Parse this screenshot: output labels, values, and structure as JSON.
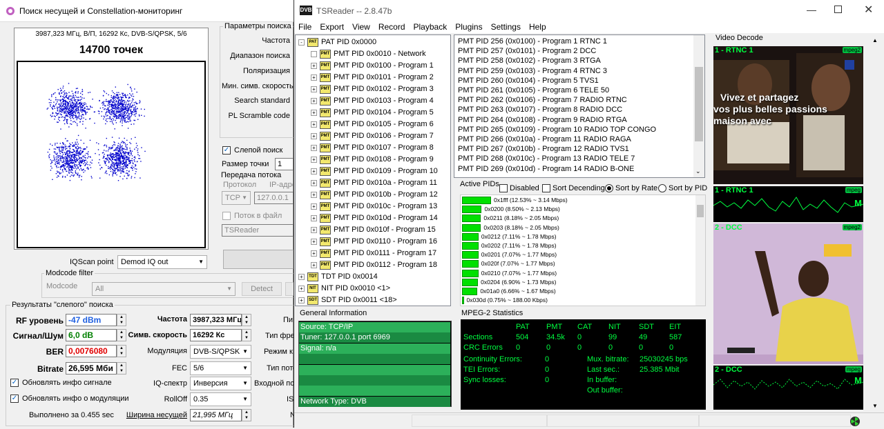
{
  "left_window": {
    "title": "Поиск несущей и Constellation-мониторинг",
    "constellation_header": "3987,323 МГц, В/П, 16292 Кс, DVB-S/QPSK, 5/6",
    "points_label": "14700 точек",
    "params_group": "Параметры поиска",
    "params_labels": [
      "Частота",
      "Диапазон поиска",
      "Поляризация",
      "Мин. симв. скорость",
      "Search standard",
      "PL Scramble code"
    ],
    "blind_search_label": "Слепой поиск",
    "point_size_label": "Размер точки",
    "point_size_value": "1",
    "stream_group": "Передача потока",
    "protocol_label": "Протокол",
    "ip_label": "IP-адре",
    "protocol_value": "TCP",
    "ip_value": "127.0.0.1",
    "stream_to_file_label": "Поток в файл",
    "tsreader_value": "TSReader",
    "iqscan_label": "IQScan point",
    "iqscan_value": "Demod IQ out",
    "modcode_group": "Modcode filter",
    "modcode_label": "Modcode",
    "modcode_value": "All",
    "detect_button": "Detect",
    "blind_results_group": "Результаты \"слепого\" поиска",
    "rf_label": "RF уровень",
    "rf_value": "-47 dBm",
    "snr_label": "Сигнал/Шум",
    "snr_value": "6,0 dB",
    "ber_label": "BER",
    "ber_value": "0,0076080",
    "bitrate_label": "Bitrate",
    "bitrate_value": "26,595 Мби",
    "freq_label": "Частота",
    "freq_value": "3987,323 МГц",
    "sr_label": "Симв. скорость",
    "sr_value": "16292 Кс",
    "mod_label": "Модуляция",
    "mod_value": "DVB-S/QPSK",
    "fec_label": "FEC",
    "fec_value": "5/6",
    "iqspec_label": "IQ-спектр",
    "iqspec_value": "Инверсия",
    "rolloff_label": "RollOff",
    "rolloff_value": "0.35",
    "width_label": "Ширина несущей",
    "width_value": "21,995 МГц",
    "update_signal_label": "Обновлять инфо сигнале",
    "update_mod_label": "Обновлять инфо о модуляции",
    "elapsed_label": "Выполнено за 0.455 sec",
    "cut_labels": [
      "Пи",
      "Тип фре",
      "Режим к",
      "Тип пото",
      "Входной пот",
      "IS",
      "N"
    ]
  },
  "tsreader": {
    "title": "TSReader -- 2.8.47b",
    "menu": [
      "File",
      "Export",
      "View",
      "Record",
      "Playback",
      "Plugins",
      "Settings",
      "Help"
    ],
    "tree": {
      "pat": "PAT PID 0x0000",
      "children": [
        "PMT PID 0x0010 - Network",
        "PMT PID 0x0100 - Program 1",
        "PMT PID 0x0101 - Program 2",
        "PMT PID 0x0102 - Program 3",
        "PMT PID 0x0103 - Program 4",
        "PMT PID 0x0104 - Program 5",
        "PMT PID 0x0105 - Program 6",
        "PMT PID 0x0106 - Program 7",
        "PMT PID 0x0107 - Program 8",
        "PMT PID 0x0108 - Program 9",
        "PMT PID 0x0109 - Program 10",
        "PMT PID 0x010a - Program 11",
        "PMT PID 0x010b - Program 12",
        "PMT PID 0x010c - Program 13",
        "PMT PID 0x010d - Program 14",
        "PMT PID 0x010f - Program 15",
        "PMT PID 0x0110 - Program 16",
        "PMT PID 0x0111 - Program 17",
        "PMT PID 0x0112 - Program 18"
      ],
      "others": [
        "TDT PID 0x0014",
        "NIT PID 0x0010 <1>",
        "SDT PID 0x0011 <18>"
      ]
    },
    "pmt_list": [
      "PMT PID 256 (0x0100) - Program 1 RTNC 1",
      "PMT PID 257 (0x0101) - Program 2 DCC",
      "PMT PID 258 (0x0102) - Program 3 RTGA",
      "PMT PID 259 (0x0103) - Program 4 RTNC 3",
      "PMT PID 260 (0x0104) - Program 5 TVS1",
      "PMT PID 261 (0x0105) - Program 6 TELE 50",
      "PMT PID 262 (0x0106) - Program 7 RADIO RTNC",
      "PMT PID 263 (0x0107) - Program 8 RADIO DCC",
      "PMT PID 264 (0x0108) - Program 9 RADIO RTGA",
      "PMT PID 265 (0x0109) - Program 10 RADIO TOP CONGO",
      "PMT PID 266 (0x010a) - Program 11 RADIO RAGA",
      "PMT PID 267 (0x010b) - Program 12 RADIO TVS1",
      "PMT PID 268 (0x010c) - Program 13 RADIO TELE 7",
      "PMT PID 269 (0x010d) - Program 14 RADIO B-ONE"
    ],
    "active_pids_label": "Active PIDs",
    "disabled_label": "Disabled",
    "sort_desc_label": "Sort Decending",
    "sort_rate_label": "Sort by Rate",
    "sort_pid_label": "Sort by PID",
    "pids": [
      {
        "label": "0x1fff (12.53% ~ 3.14 Mbps)",
        "pct": 12.53
      },
      {
        "label": "0x0200 (8.50% ~ 2.13 Mbps)",
        "pct": 8.5
      },
      {
        "label": "0x0211 (8.18% ~ 2.05 Mbps)",
        "pct": 8.18
      },
      {
        "label": "0x0203 (8.18% ~ 2.05 Mbps)",
        "pct": 8.18
      },
      {
        "label": "0x0212 (7.11% ~ 1.78 Mbps)",
        "pct": 7.11
      },
      {
        "label": "0x0202 (7.11% ~ 1.78 Mbps)",
        "pct": 7.11
      },
      {
        "label": "0x0201 (7.07% ~ 1.77 Mbps)",
        "pct": 7.07
      },
      {
        "label": "0x020f (7.07% ~ 1.77 Mbps)",
        "pct": 7.07
      },
      {
        "label": "0x0210 (7.07% ~ 1.77 Mbps)",
        "pct": 7.07
      },
      {
        "label": "0x0204 (6.90% ~ 1.73 Mbps)",
        "pct": 6.9
      },
      {
        "label": "0x01a0 (6.66% ~ 1.67 Mbps)",
        "pct": 6.66
      },
      {
        "label": "0x030d (0.75% ~ 188.00 Kbps)",
        "pct": 0.75
      }
    ],
    "general_info_label": "General Information",
    "general_info": [
      "Source: TCP/IP",
      "Tuner: 127.0.0.1 port 6969",
      "Signal: n/a",
      "",
      "",
      "",
      "",
      "Network Type: DVB"
    ],
    "mpeg_stats_label": "MPEG-2 Statistics",
    "stats_headers": [
      "PAT",
      "PMT",
      "CAT",
      "NIT",
      "SDT",
      "EIT"
    ],
    "sections_label": "Sections",
    "sections": [
      "504",
      "34.5k",
      "0",
      "99",
      "49",
      "587"
    ],
    "crc_label": "CRC Errors",
    "crc": [
      "0",
      "0",
      "0",
      "0",
      "0",
      "0"
    ],
    "cont_label": "Continuity Errors:",
    "cont_value": "0",
    "tei_label": "TEI Errors:",
    "tei_value": "0",
    "sync_label": "Sync losses:",
    "sync_value": "0",
    "mux_label": "Mux. bitrate:",
    "mux_value": "25030245 bps",
    "last_label": "Last sec.:",
    "last_value": "25.385 Mbit",
    "inbuf_label": "In buffer:",
    "outbuf_label": "Out buffer:",
    "video_decode_label": "Video Decode",
    "videos": [
      {
        "title": "1 - RTNC 1",
        "badge": "mpeg2"
      },
      {
        "title": "1 - RTNC 1",
        "badge": "mpeg"
      },
      {
        "title": "2 - DCC",
        "badge": "mpeg2"
      },
      {
        "title": "2 - DCC",
        "badge": "mpeg"
      }
    ],
    "video1_caption": [
      "Vivez et partagez",
      "vos plus belles passions",
      "maison avec"
    ],
    "m_label": "M"
  }
}
